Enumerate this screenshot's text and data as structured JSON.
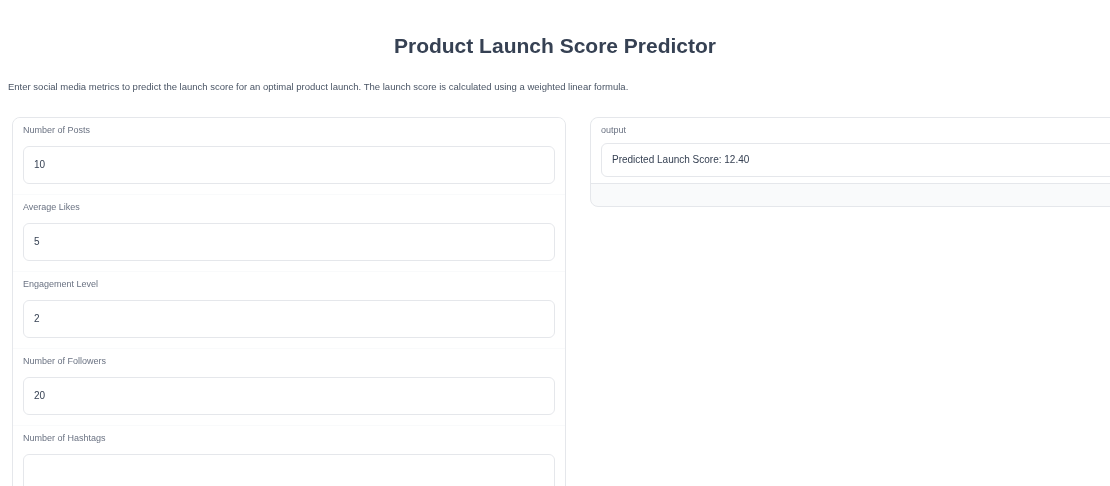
{
  "title": "Product Launch Score Predictor",
  "description": "Enter social media metrics to predict the launch score for an optimal product launch. The launch score is calculated using a weighted linear formula.",
  "inputs": [
    {
      "label": "Number of Posts",
      "value": "10"
    },
    {
      "label": "Average Likes",
      "value": "5"
    },
    {
      "label": "Engagement Level",
      "value": "2"
    },
    {
      "label": "Number of Followers",
      "value": "20"
    },
    {
      "label": "Number of Hashtags"
    }
  ],
  "output": {
    "label": "output",
    "value": "Predicted Launch Score: 12.40"
  }
}
